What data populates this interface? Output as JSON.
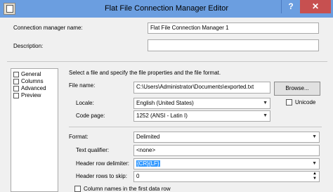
{
  "window": {
    "title": "Flat File Connection Manager Editor",
    "help": "?",
    "close": "✕"
  },
  "connection_name_label": "Connection manager name:",
  "connection_name_value": "Flat File Connection Manager 1",
  "description_label": "Description:",
  "description_value": "",
  "nav": [
    "General",
    "Columns",
    "Advanced",
    "Preview"
  ],
  "instructions": "Select a file and specify the file properties and the file format.",
  "file_name_label": "File name:",
  "file_name_value": "C:\\Users\\Administrator\\Documents\\exported.txt",
  "browse_label": "Browse...",
  "locale_label": "Locale:",
  "locale_value": "English (United States)",
  "unicode_label": "Unicode",
  "code_page_label": "Code page:",
  "code_page_value": "1252  (ANSI - Latin I)",
  "format_label": "Format:",
  "format_value": "Delimited",
  "text_qualifier_label": "Text qualifier:",
  "text_qualifier_value": "<none>",
  "header_delim_label": "Header row delimiter:",
  "header_delim_value": "{CR}{LF}",
  "header_skip_label": "Header rows to skip:",
  "header_skip_value": "0",
  "column_names_label": "Column names in the first data row"
}
